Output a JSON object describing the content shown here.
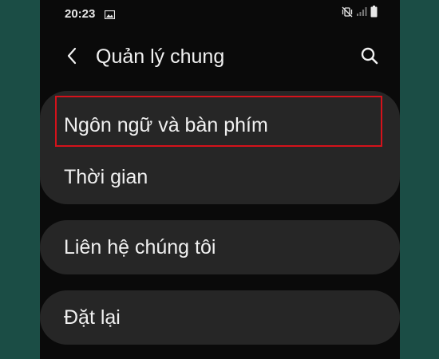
{
  "status_bar": {
    "time": "20:23",
    "icons": [
      "gallery-icon",
      "mute-vibrate-icon",
      "signal-icon",
      "battery-icon"
    ]
  },
  "app_bar": {
    "title": "Quản lý chung",
    "back_icon": "back-arrow-icon",
    "search_icon": "search-icon"
  },
  "settings": {
    "group_1": [
      "Ngôn ngữ và bàn phím",
      "Thời gian"
    ],
    "group_2": [
      "Liên hệ chúng tôi"
    ],
    "group_3": [
      "Đặt lại"
    ]
  },
  "colors": {
    "background_outer": "#1b4d45",
    "screen_background": "#0a0a0a",
    "card_background": "#262626",
    "highlight": "#d5121b"
  }
}
